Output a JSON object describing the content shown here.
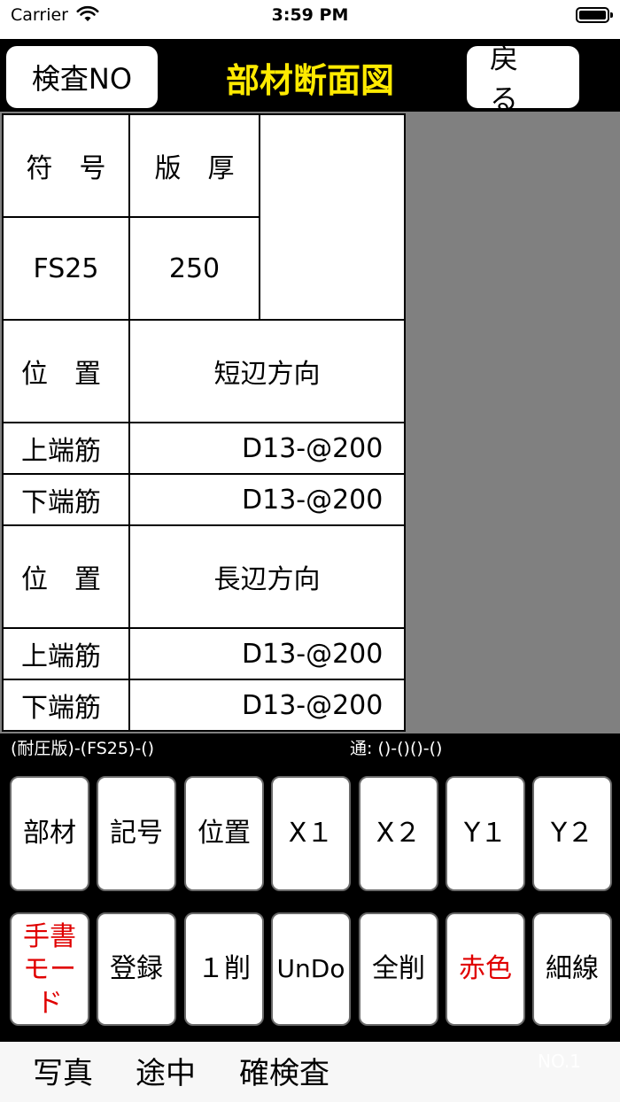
{
  "status": {
    "carrier": "Carrier",
    "time": "3:59 PM"
  },
  "nav": {
    "left_button": "検査NO",
    "title": "部材断面図",
    "right_button": "戻る"
  },
  "table": {
    "header": {
      "symbol_label": "符　号",
      "thickness_label": "版　厚"
    },
    "member": {
      "symbol": "FS25",
      "thickness": "250"
    },
    "short_direction": {
      "position_label": "位　置",
      "direction": "短辺方向",
      "rows": [
        {
          "label": "上端筋",
          "value": "D13-@200"
        },
        {
          "label": "下端筋",
          "value": "D13-@200"
        }
      ]
    },
    "long_direction": {
      "position_label": "位　置",
      "direction": "長辺方向",
      "rows": [
        {
          "label": "上端筋",
          "value": "D13-@200"
        },
        {
          "label": "下端筋",
          "value": "D13-@200"
        }
      ]
    }
  },
  "info": {
    "left": "(耐圧版)-(FS25)-()",
    "right": "通: ()-()()-()"
  },
  "keys_row1": [
    "部材",
    "記号",
    "位置",
    "X１",
    "X２",
    "Y１",
    "Y２"
  ],
  "keys_row2": {
    "handwrite": "手書モード",
    "register": "登録",
    "delete_one": "１削",
    "undo": "UnDo",
    "delete_all": "全削",
    "red_color": "赤色",
    "thin_line": "細線"
  },
  "toolbar": {
    "photo": "写真",
    "midway": "途中",
    "confirm": "確検査",
    "number": "NO.1"
  },
  "colors": {
    "title": "#ffea00",
    "red_key": "#e00000",
    "panel": "#808080"
  }
}
